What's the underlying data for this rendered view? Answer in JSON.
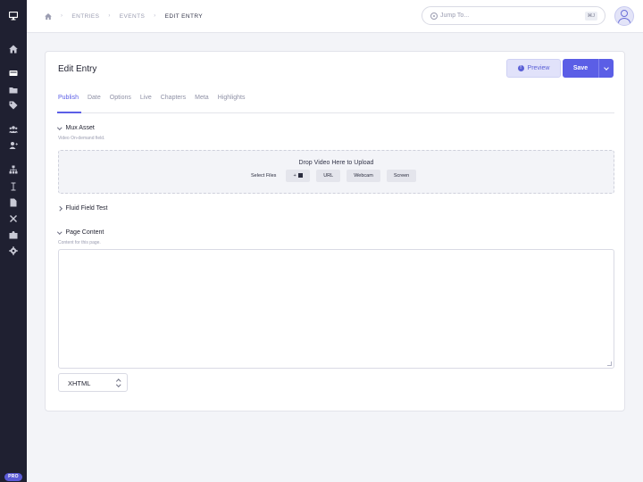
{
  "sidebar": {
    "icons": [
      "monitor-icon",
      "home-icon",
      "entries-icon",
      "folder-icon",
      "tags-icon",
      "members-icon",
      "member-add-icon",
      "sitemap-icon",
      "text-cursor-icon",
      "file-icon",
      "tools-icon",
      "addons-icon",
      "gear-icon"
    ],
    "badge": "PRO"
  },
  "breadcrumb": {
    "items": [
      "ENTRIES",
      "EVENTS"
    ],
    "current": "EDIT ENTRY"
  },
  "search": {
    "placeholder": "Jump To...",
    "shortcut": "⌘J"
  },
  "entry": {
    "title": "Edit Entry",
    "preview_label": "Preview",
    "save_label": "Save"
  },
  "tabs": [
    "Publish",
    "Date",
    "Options",
    "Live",
    "Chapters",
    "Meta",
    "Highlights"
  ],
  "mux_asset": {
    "label": "Mux Asset",
    "description": "Video On-demand field.",
    "drop_title": "Drop Video Here to Upload",
    "select_files": "Select Files",
    "add_label": "+",
    "url_label": "URL",
    "webcam_label": "Webcam",
    "screen_label": "Screen"
  },
  "fluid_field": {
    "label": "Fluid Field Test"
  },
  "page_content": {
    "label": "Page Content",
    "description": "Content for this page.",
    "value": "",
    "format": "XHTML"
  },
  "colors": {
    "accent": "#5b5ee6",
    "sidebar": "#1f2031",
    "background": "#f3f4f8"
  }
}
